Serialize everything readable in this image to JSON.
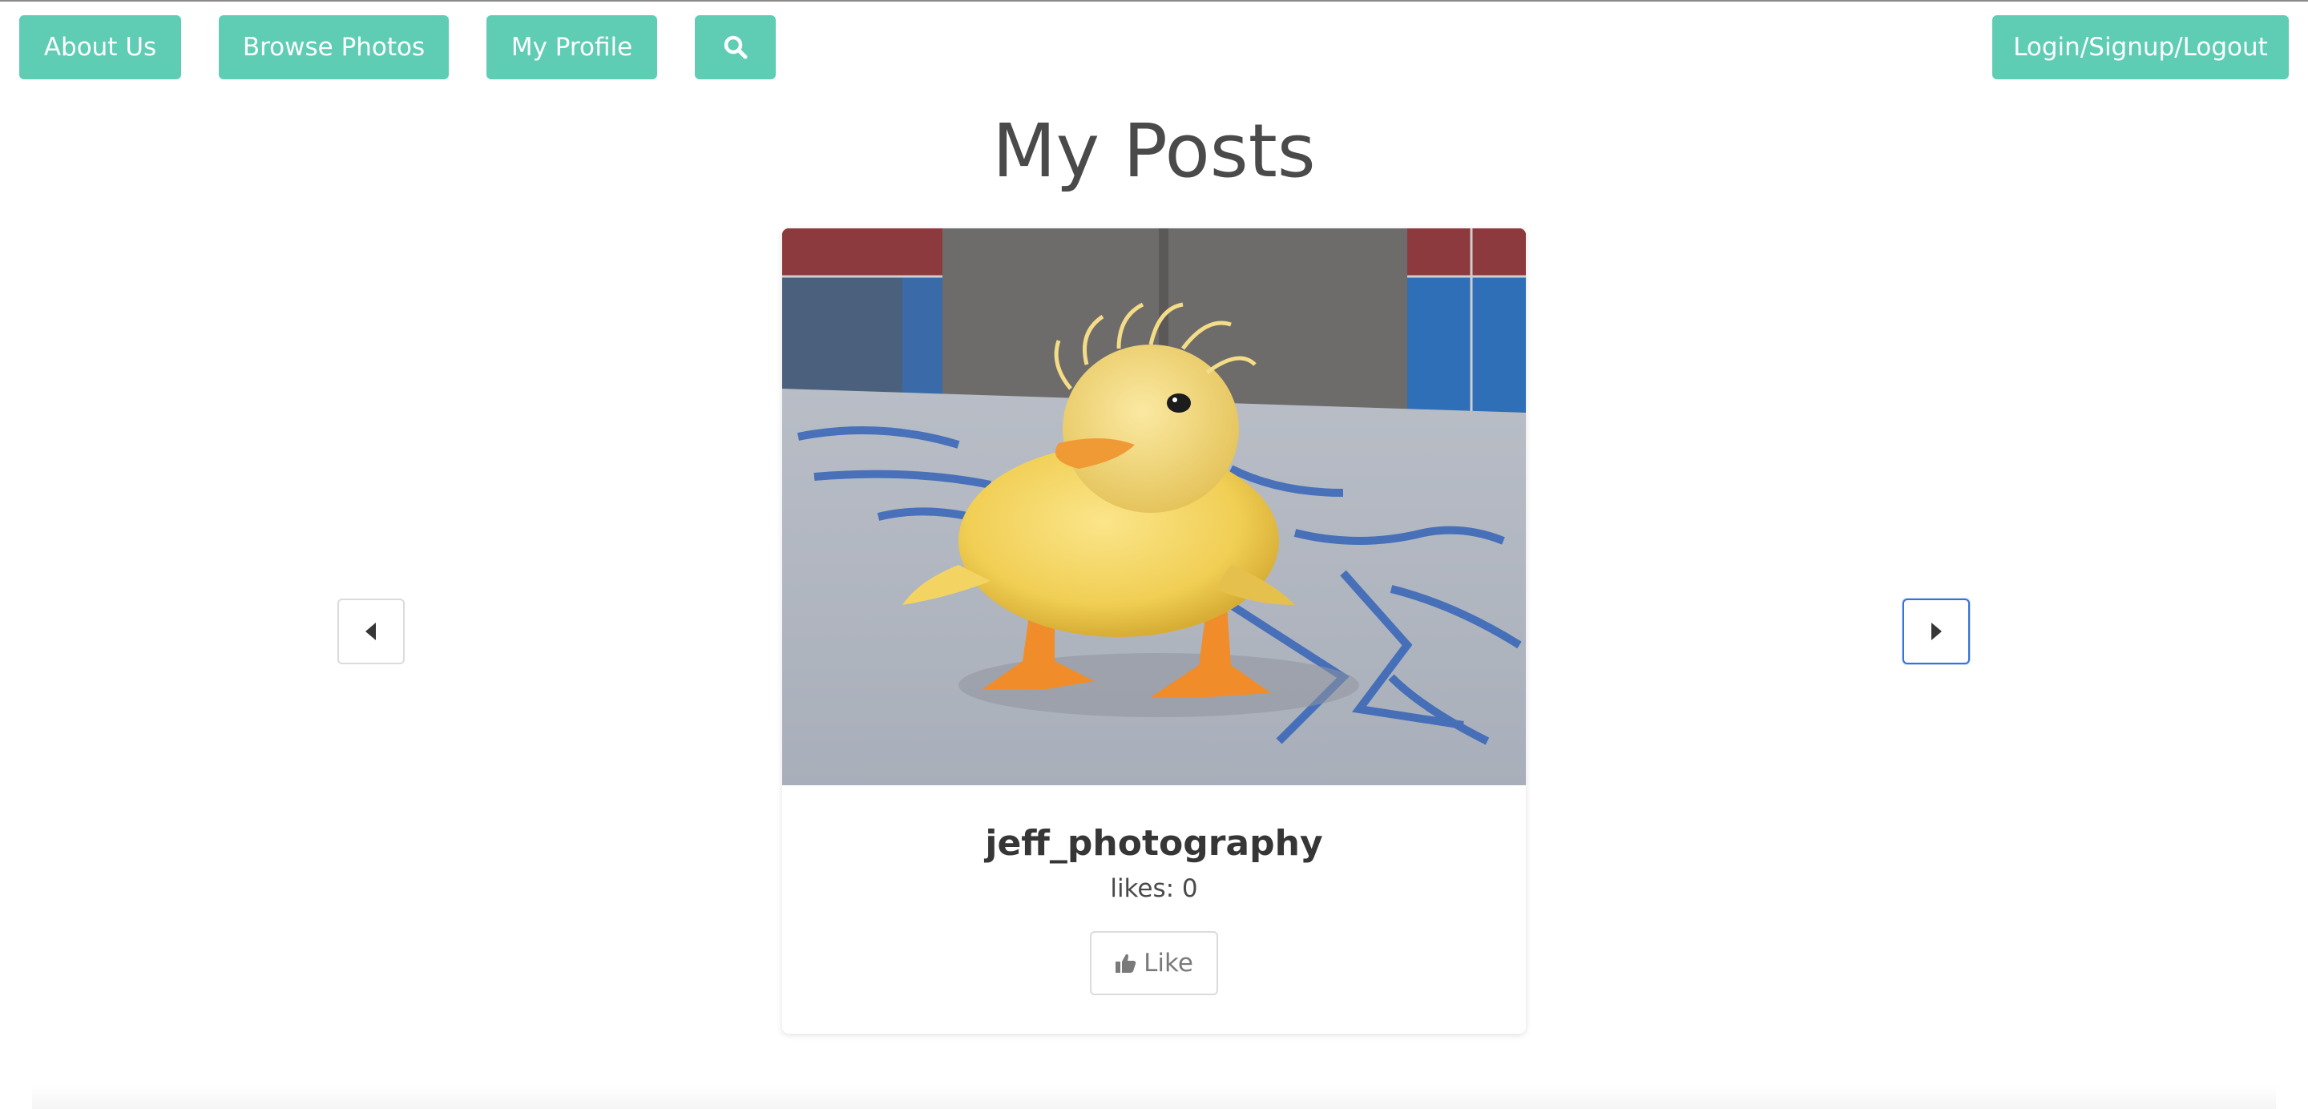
{
  "nav": {
    "about": "About Us",
    "browse": "Browse Photos",
    "profile": "My Profile",
    "search_icon": "search-icon",
    "login": "Login/Signup/Logout"
  },
  "page": {
    "title": "My Posts"
  },
  "post": {
    "username": "jeff_photography",
    "likes": "likes: 0",
    "like_label": "Like",
    "like_icon": "thumbs-up-icon"
  },
  "carousel": {
    "prev_icon": "caret-left-icon",
    "next_icon": "caret-right-icon"
  },
  "colors": {
    "nav_button": "#5fcdb4",
    "title": "#4a4a4a",
    "focus_border": "#3273dc"
  }
}
